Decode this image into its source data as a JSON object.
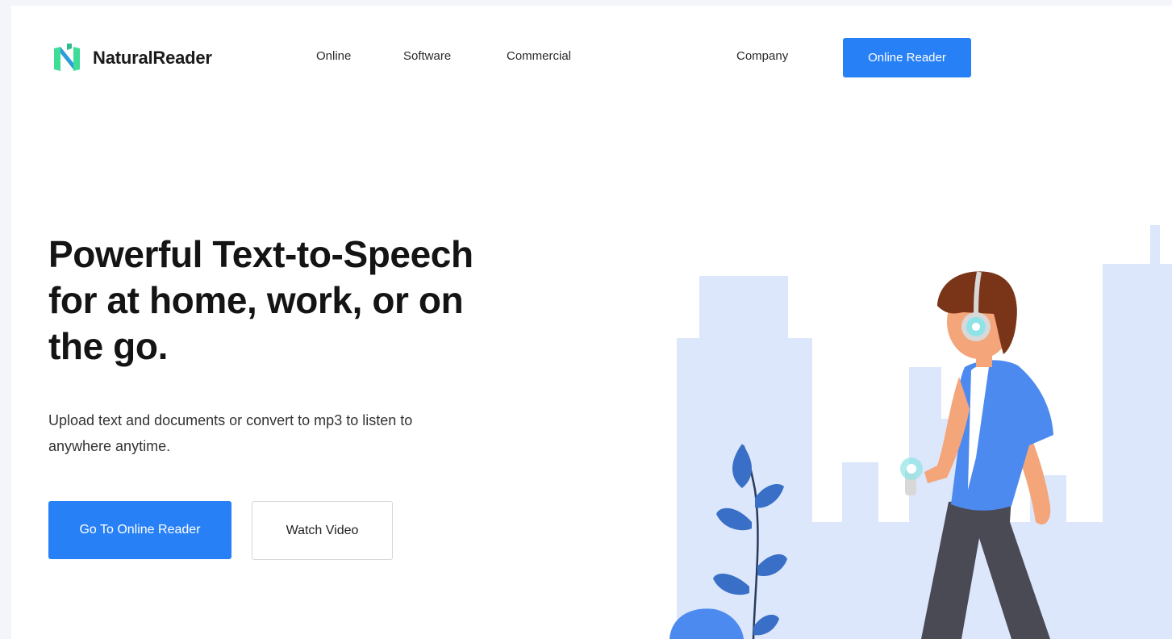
{
  "brand": {
    "name": "NaturalReader"
  },
  "nav": {
    "online": "Online",
    "software": "Software",
    "commercial": "Commercial",
    "company": "Company",
    "cta": "Online Reader"
  },
  "hero": {
    "title_line1": "Powerful Text-to-Speech",
    "title_line2": "for at home, work, or on",
    "title_line3": "the go.",
    "subtitle_line1": "Upload text and documents or convert to mp3 to listen to",
    "subtitle_line2": "anywhere anytime.",
    "primary_button": "Go To Online Reader",
    "secondary_button": "Watch Video"
  },
  "colors": {
    "accent": "#2880f6",
    "buildings": "#dce7fb",
    "shirt": "#4d8af0",
    "hair": "#7a3518",
    "skin": "#f5a57a",
    "pants": "#4a4a55",
    "leaf": "#3a6fc7"
  }
}
